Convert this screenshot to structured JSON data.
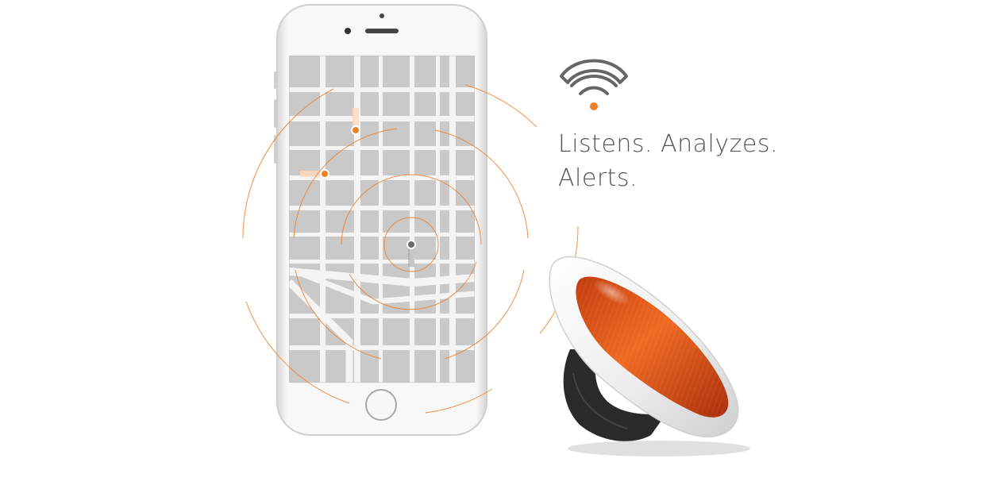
{
  "tagline": {
    "line1": "Listens. Analyzes.",
    "line2": "Alerts."
  },
  "icons": {
    "signal": "wifi-signal-icon"
  },
  "colors": {
    "accent": "#f07e26",
    "device_lens": "#e4571b",
    "phone_body": "#f4f4f4",
    "map_block": "#c9c9c9",
    "map_street": "#f7f7f7",
    "text": "#555555",
    "icon_gray": "#666666"
  }
}
